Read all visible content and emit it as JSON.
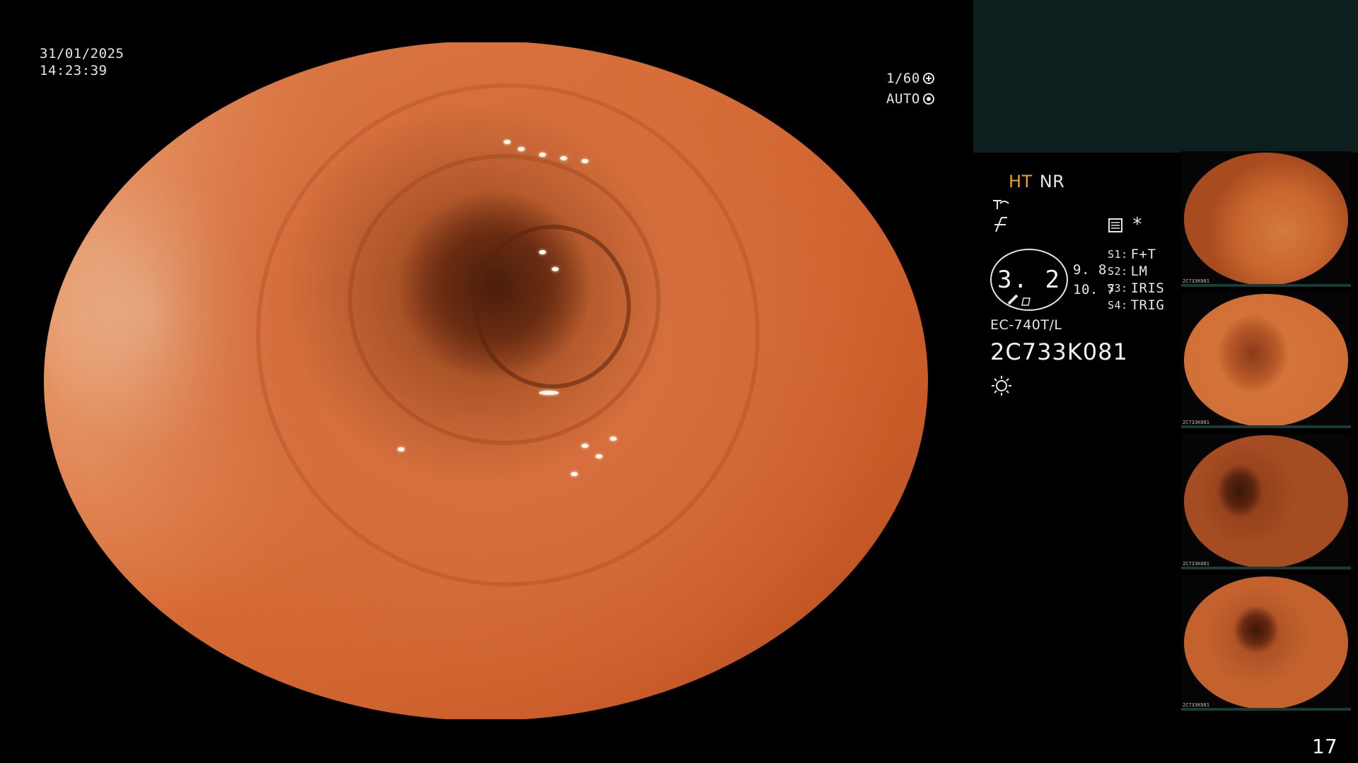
{
  "overlay": {
    "date": "31/01/2025",
    "time": "14:23:39",
    "shutter": "1/60",
    "exposure": "AUTO"
  },
  "status": {
    "mode_ht": "HT",
    "mode_nr": "NR",
    "zoom": "3. 2",
    "value_a": "9. 8",
    "value_b": "10. 7",
    "asterisk": "*",
    "scope_settings": [
      {
        "key": "S1:",
        "value": "F+T"
      },
      {
        "key": "S2:",
        "value": "LM"
      },
      {
        "key": "S3:",
        "value": "IRIS"
      },
      {
        "key": "S4:",
        "value": "TRIG"
      }
    ],
    "model": "EC-740T/L",
    "serial": "2C733K081"
  },
  "thumbnails": [
    {
      "label": "2C733K081"
    },
    {
      "label": "2C733K081"
    },
    {
      "label": "2C733K081"
    },
    {
      "label": "2C733K081"
    }
  ],
  "page_number": "17",
  "colors": {
    "ht_accent": "#f0a020",
    "panel_bg": "#0c1e1e",
    "text": "#e6e6e6"
  },
  "icons": [
    "shutter-icon",
    "auto-iris-icon",
    "enhance-icon",
    "freeze-icon",
    "memory-icon",
    "light-icon"
  ]
}
